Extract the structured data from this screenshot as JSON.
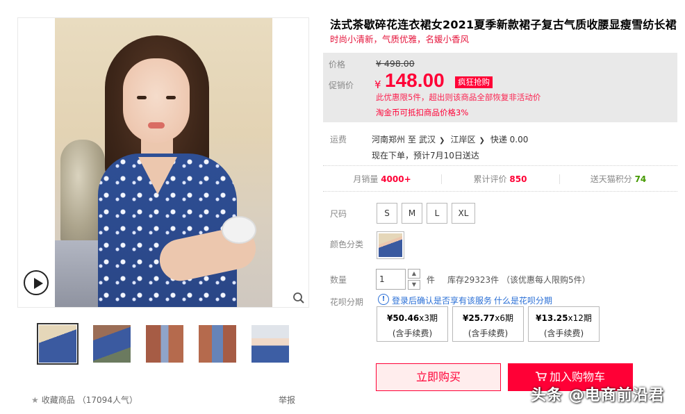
{
  "gallery": {
    "thumbnails": [
      "thumb-1",
      "thumb-2",
      "thumb-3",
      "thumb-4",
      "thumb-5"
    ],
    "active_thumbnail": 1,
    "favorite_label": "收藏商品",
    "favorite_count": "（17094人气）",
    "report_label": "举报"
  },
  "product": {
    "title": "法式茶歇碎花连衣裙女2021夏季新款裙子复古气质收腰显瘦雪纺长裙",
    "subtitle": "时尚小清新，气质优雅，名媛小香风"
  },
  "price": {
    "price_label": "价格",
    "original_price": "¥ 498.00",
    "sale_label": "促销价",
    "currency": "¥",
    "sale_price": "148.00",
    "promo_tag": "疯狂抢购",
    "promo_note": "此优惠限5件，超出则该商品全部恢复非活动价",
    "coin_note": "淘金币可抵扣商品价格3%"
  },
  "shipping": {
    "label": "运费",
    "origin": "河南郑州",
    "to": "至",
    "city": "武汉",
    "district": "江岸区",
    "express": "快递 0.00",
    "delivery": "现在下单，预计7月10日送达"
  },
  "stats": {
    "monthly_sales_label": "月销量",
    "monthly_sales": "4000+",
    "reviews_label": "累计评价",
    "reviews": "850",
    "points_label": "送天猫积分",
    "points": "74"
  },
  "options": {
    "size_label": "尺码",
    "sizes": [
      "S",
      "M",
      "L",
      "XL"
    ],
    "color_label": "颜色分类",
    "quantity_label": "数量",
    "quantity": "1",
    "quantity_unit": "件",
    "stock": "库存29323件 （该优惠每人限购5件）"
  },
  "huabei": {
    "label": "花呗分期",
    "login_text": "登录后确认是否享有该服务",
    "what_link": "什么是花呗分期",
    "plans": [
      {
        "amount": "¥50.46",
        "periods": "x3期",
        "fee": "(含手续费)"
      },
      {
        "amount": "¥25.77",
        "periods": "x6期",
        "fee": "(含手续费)"
      },
      {
        "amount": "¥13.25",
        "periods": "x12期",
        "fee": "(含手续费)"
      }
    ]
  },
  "actions": {
    "buy_now": "立即购买",
    "add_to_cart": "加入购物车"
  },
  "watermark": "头条 @电商前沿君",
  "colors": {
    "accent": "#ff0036",
    "link": "#2a6fd6",
    "points_green": "#449900"
  }
}
